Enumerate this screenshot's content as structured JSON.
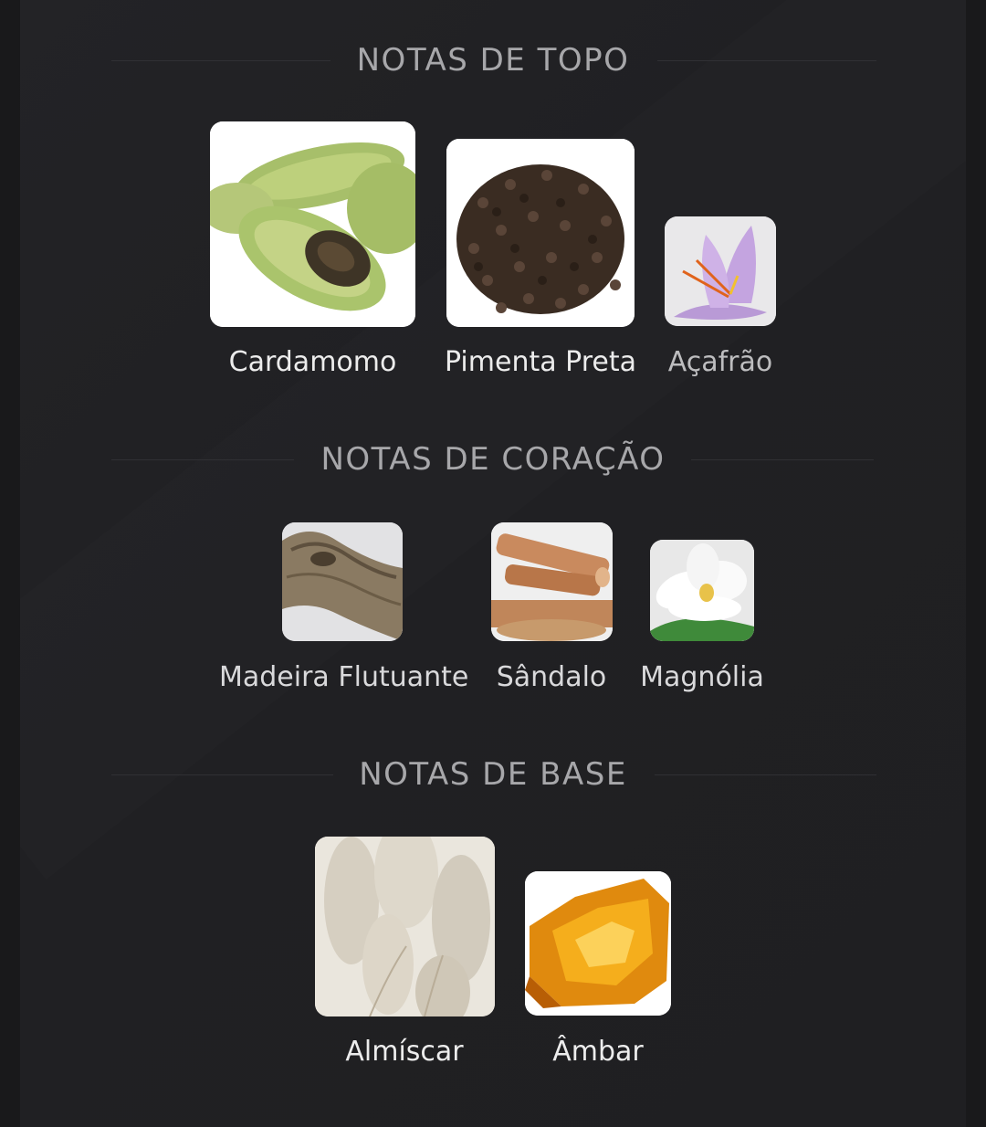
{
  "sections": [
    {
      "title": "NOTAS DE TOPO",
      "notes": [
        {
          "label": "Cardamomo",
          "icon": "cardamom-image"
        },
        {
          "label": "Pimenta Preta",
          "icon": "black-pepper-image"
        },
        {
          "label": "Açafrão",
          "icon": "saffron-image"
        }
      ]
    },
    {
      "title": "NOTAS DE CORAÇÃO",
      "notes": [
        {
          "label": "Madeira Flutuante",
          "icon": "driftwood-image"
        },
        {
          "label": "Sândalo",
          "icon": "sandalwood-image"
        },
        {
          "label": "Magnólia",
          "icon": "magnolia-image"
        }
      ]
    },
    {
      "title": "NOTAS DE BASE",
      "notes": [
        {
          "label": "Almíscar",
          "icon": "musk-image"
        },
        {
          "label": "Âmbar",
          "icon": "amber-image"
        }
      ]
    }
  ],
  "colors": {
    "background": "#19191b",
    "panel": "#222225",
    "title_text": "#a7a7aa",
    "label_primary": "#ececec",
    "label_secondary": "#bdbdbf"
  }
}
